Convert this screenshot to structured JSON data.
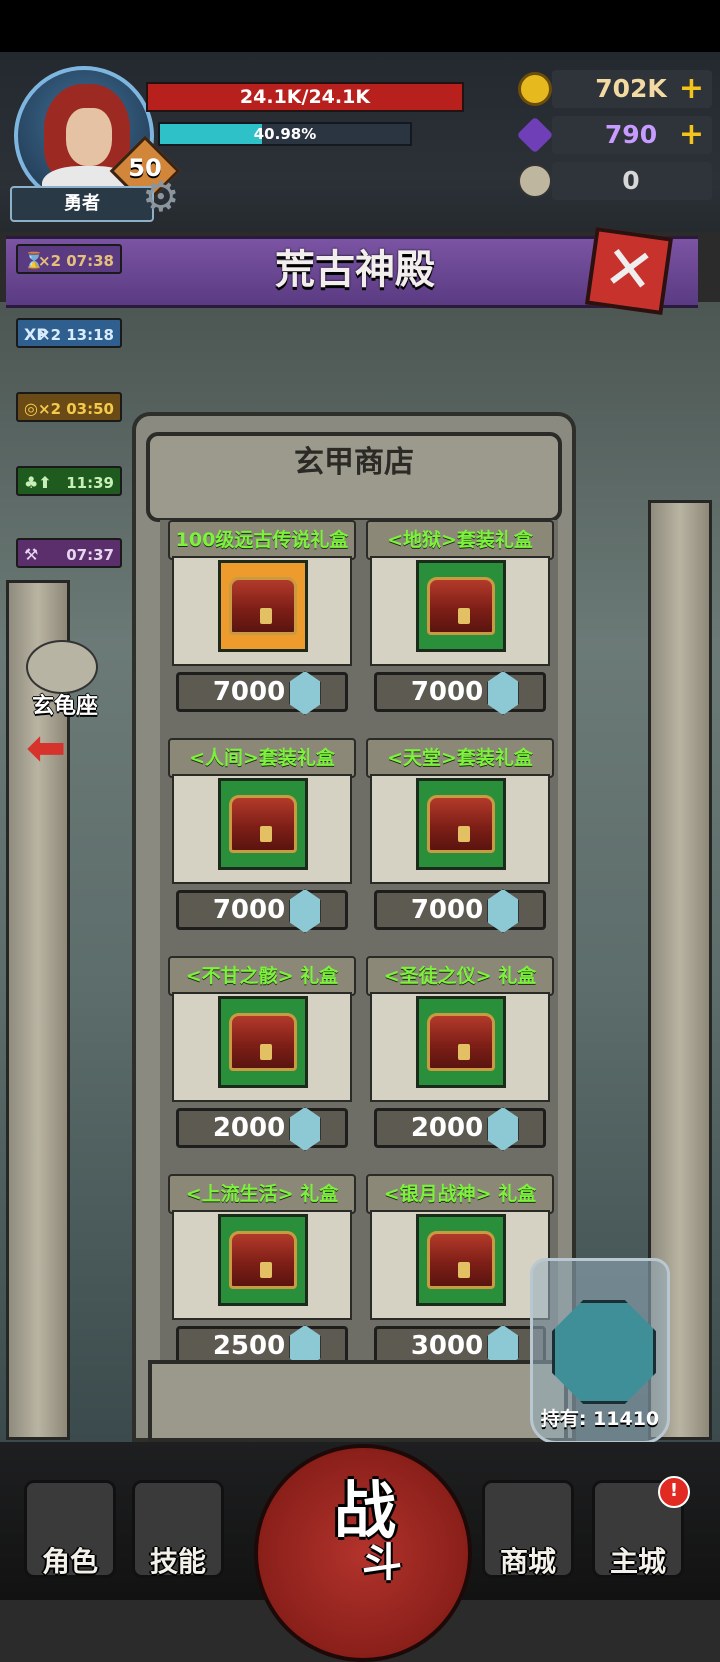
{
  "player": {
    "hp_text": "24.1K/24.1K",
    "xp_text": "40.98%",
    "xp_fraction": 0.4098,
    "level": "50",
    "name": "勇者"
  },
  "currencies": [
    {
      "name": "gold-coin-icon",
      "value": "702K",
      "has_plus": true,
      "plus": "+"
    },
    {
      "name": "purple-crystal-icon",
      "value": "790",
      "has_plus": true,
      "plus": "+"
    },
    {
      "name": "ram-horn-icon",
      "value": "0",
      "has_plus": false,
      "plus": ""
    }
  ],
  "banner": {
    "title": "荒古神殿",
    "close_glyph": "✕"
  },
  "buffs": [
    {
      "icon": "hourglass-icon",
      "icon_glyph": "⌛",
      "text": "×2 07:38",
      "bg": "#5a3b82",
      "color": "#e6c07a"
    },
    {
      "icon": "xp-icon",
      "icon_glyph": "XP",
      "text": "×2 13:18",
      "bg": "#2f5f8e",
      "color": "#d9ecff"
    },
    {
      "icon": "coin-icon",
      "icon_glyph": "◎",
      "text": "×2 03:50",
      "bg": "#6a4b16",
      "color": "#f5c94a"
    },
    {
      "icon": "clover-icon",
      "icon_glyph": "♣⬆",
      "text": "11:39",
      "bg": "#1f5a1f",
      "color": "#c7f0b8"
    },
    {
      "icon": "hammer-icon",
      "icon_glyph": "⚒",
      "text": "07:37",
      "bg": "#5b2f6b",
      "color": "#e7d6f0"
    }
  ],
  "constellation": {
    "label": "玄龟座"
  },
  "shop": {
    "title": "玄甲商店",
    "items": [
      {
        "title": "100级远古传说礼盒",
        "price": "7000",
        "frame": "gold"
      },
      {
        "title": "<地狱>套装礼盒",
        "price": "7000",
        "frame": "green"
      },
      {
        "title": "<人间>套装礼盒",
        "price": "7000",
        "frame": "green"
      },
      {
        "title": "<天堂>套装礼盒",
        "price": "7000",
        "frame": "green"
      },
      {
        "title": "<不甘之骸> 礼盒",
        "price": "2000",
        "frame": "green"
      },
      {
        "title": "<圣徒之仪> 礼盒",
        "price": "2000",
        "frame": "green"
      },
      {
        "title": "<上流生活> 礼盒",
        "price": "2500",
        "frame": "green"
      },
      {
        "title": "<银月战神> 礼盒",
        "price": "3000",
        "frame": "green"
      }
    ]
  },
  "jar": {
    "label": "持有: 11410"
  },
  "nav": {
    "role": "角色",
    "skill": "技能",
    "battle": "战",
    "battle_sub": "斗",
    "shop": "商城",
    "city": "主城",
    "city_alert": "!"
  },
  "colors": {
    "accent_purple": "#7b54a3",
    "hp_red": "#b8201d",
    "xp_cyan": "#2ec1c8",
    "price_green": "#7cf23c"
  }
}
